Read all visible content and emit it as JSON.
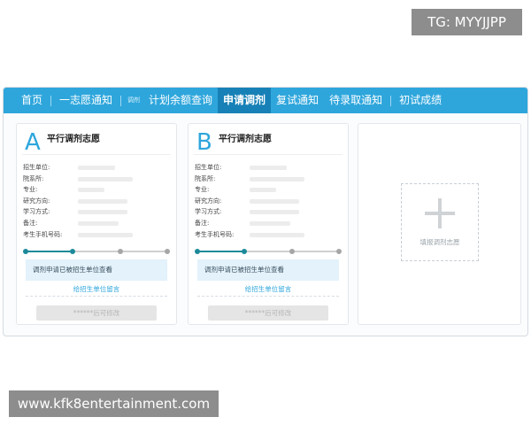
{
  "watermark": {
    "tg": "TG: MYYJJPP",
    "url": "www.kfk8entertainment.com"
  },
  "nav": {
    "items": [
      {
        "label": "首页"
      },
      {
        "label": "一志愿通知"
      },
      {
        "label": "调剂"
      },
      {
        "label": "计划余额查询"
      },
      {
        "label": "申请调剂"
      },
      {
        "label": "复试通知"
      },
      {
        "label": "待录取通知"
      },
      {
        "label": "初试成绩"
      }
    ],
    "active_label": "申请调剂"
  },
  "cards": [
    {
      "letter": "A",
      "title": "平行调剂志愿",
      "fields": [
        {
          "label": "招生单位:"
        },
        {
          "label": "院系所:"
        },
        {
          "label": "专业:"
        },
        {
          "label": "研究方向:"
        },
        {
          "label": "学习方式:"
        },
        {
          "label": "备注:"
        },
        {
          "label": "考生手机号码:"
        }
      ],
      "progress": {
        "steps": 4,
        "completed": 2
      },
      "notice": "调剂申请已被招生单位查看",
      "message_link": "给招生单位留言",
      "action_button": "******后可修改"
    },
    {
      "letter": "B",
      "title": "平行调剂志愿",
      "fields": [
        {
          "label": "招生单位:"
        },
        {
          "label": "院系所:"
        },
        {
          "label": "专业:"
        },
        {
          "label": "研究方向:"
        },
        {
          "label": "学习方式:"
        },
        {
          "label": "备注:"
        },
        {
          "label": "考生手机号码:"
        }
      ],
      "progress": {
        "steps": 4,
        "completed": 2
      },
      "notice": "调剂申请已被招生单位查看",
      "message_link": "给招生单位留言",
      "action_button": "******后可修改"
    }
  ],
  "add_card": {
    "label": "填报调剂志愿",
    "icon": "plus-icon"
  },
  "colors": {
    "accent": "#2ea6dc",
    "nav_active": "#1781b7",
    "progress": "#1c8a9a"
  }
}
